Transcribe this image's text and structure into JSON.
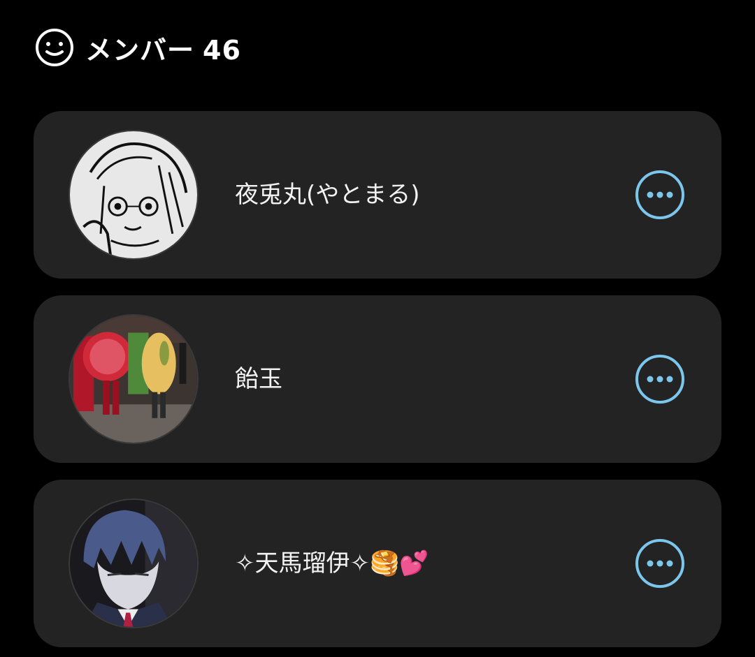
{
  "header": {
    "icon": "smiley-icon",
    "title": "メンバー",
    "count": "46"
  },
  "members": [
    {
      "name": "夜兎丸(やとまる)",
      "avatar": "avatar-sketch-girl",
      "action_icon": "more-icon"
    },
    {
      "name": "飴玉",
      "avatar": "avatar-street-costumes",
      "action_icon": "more-icon"
    },
    {
      "name": "✧天馬瑠伊✧🥞💕",
      "avatar": "avatar-blue-hair-boy",
      "action_icon": "more-icon"
    }
  ],
  "colors": {
    "background": "#000000",
    "card": "#232323",
    "accent": "#7cc6ec",
    "text": "#ffffff"
  }
}
